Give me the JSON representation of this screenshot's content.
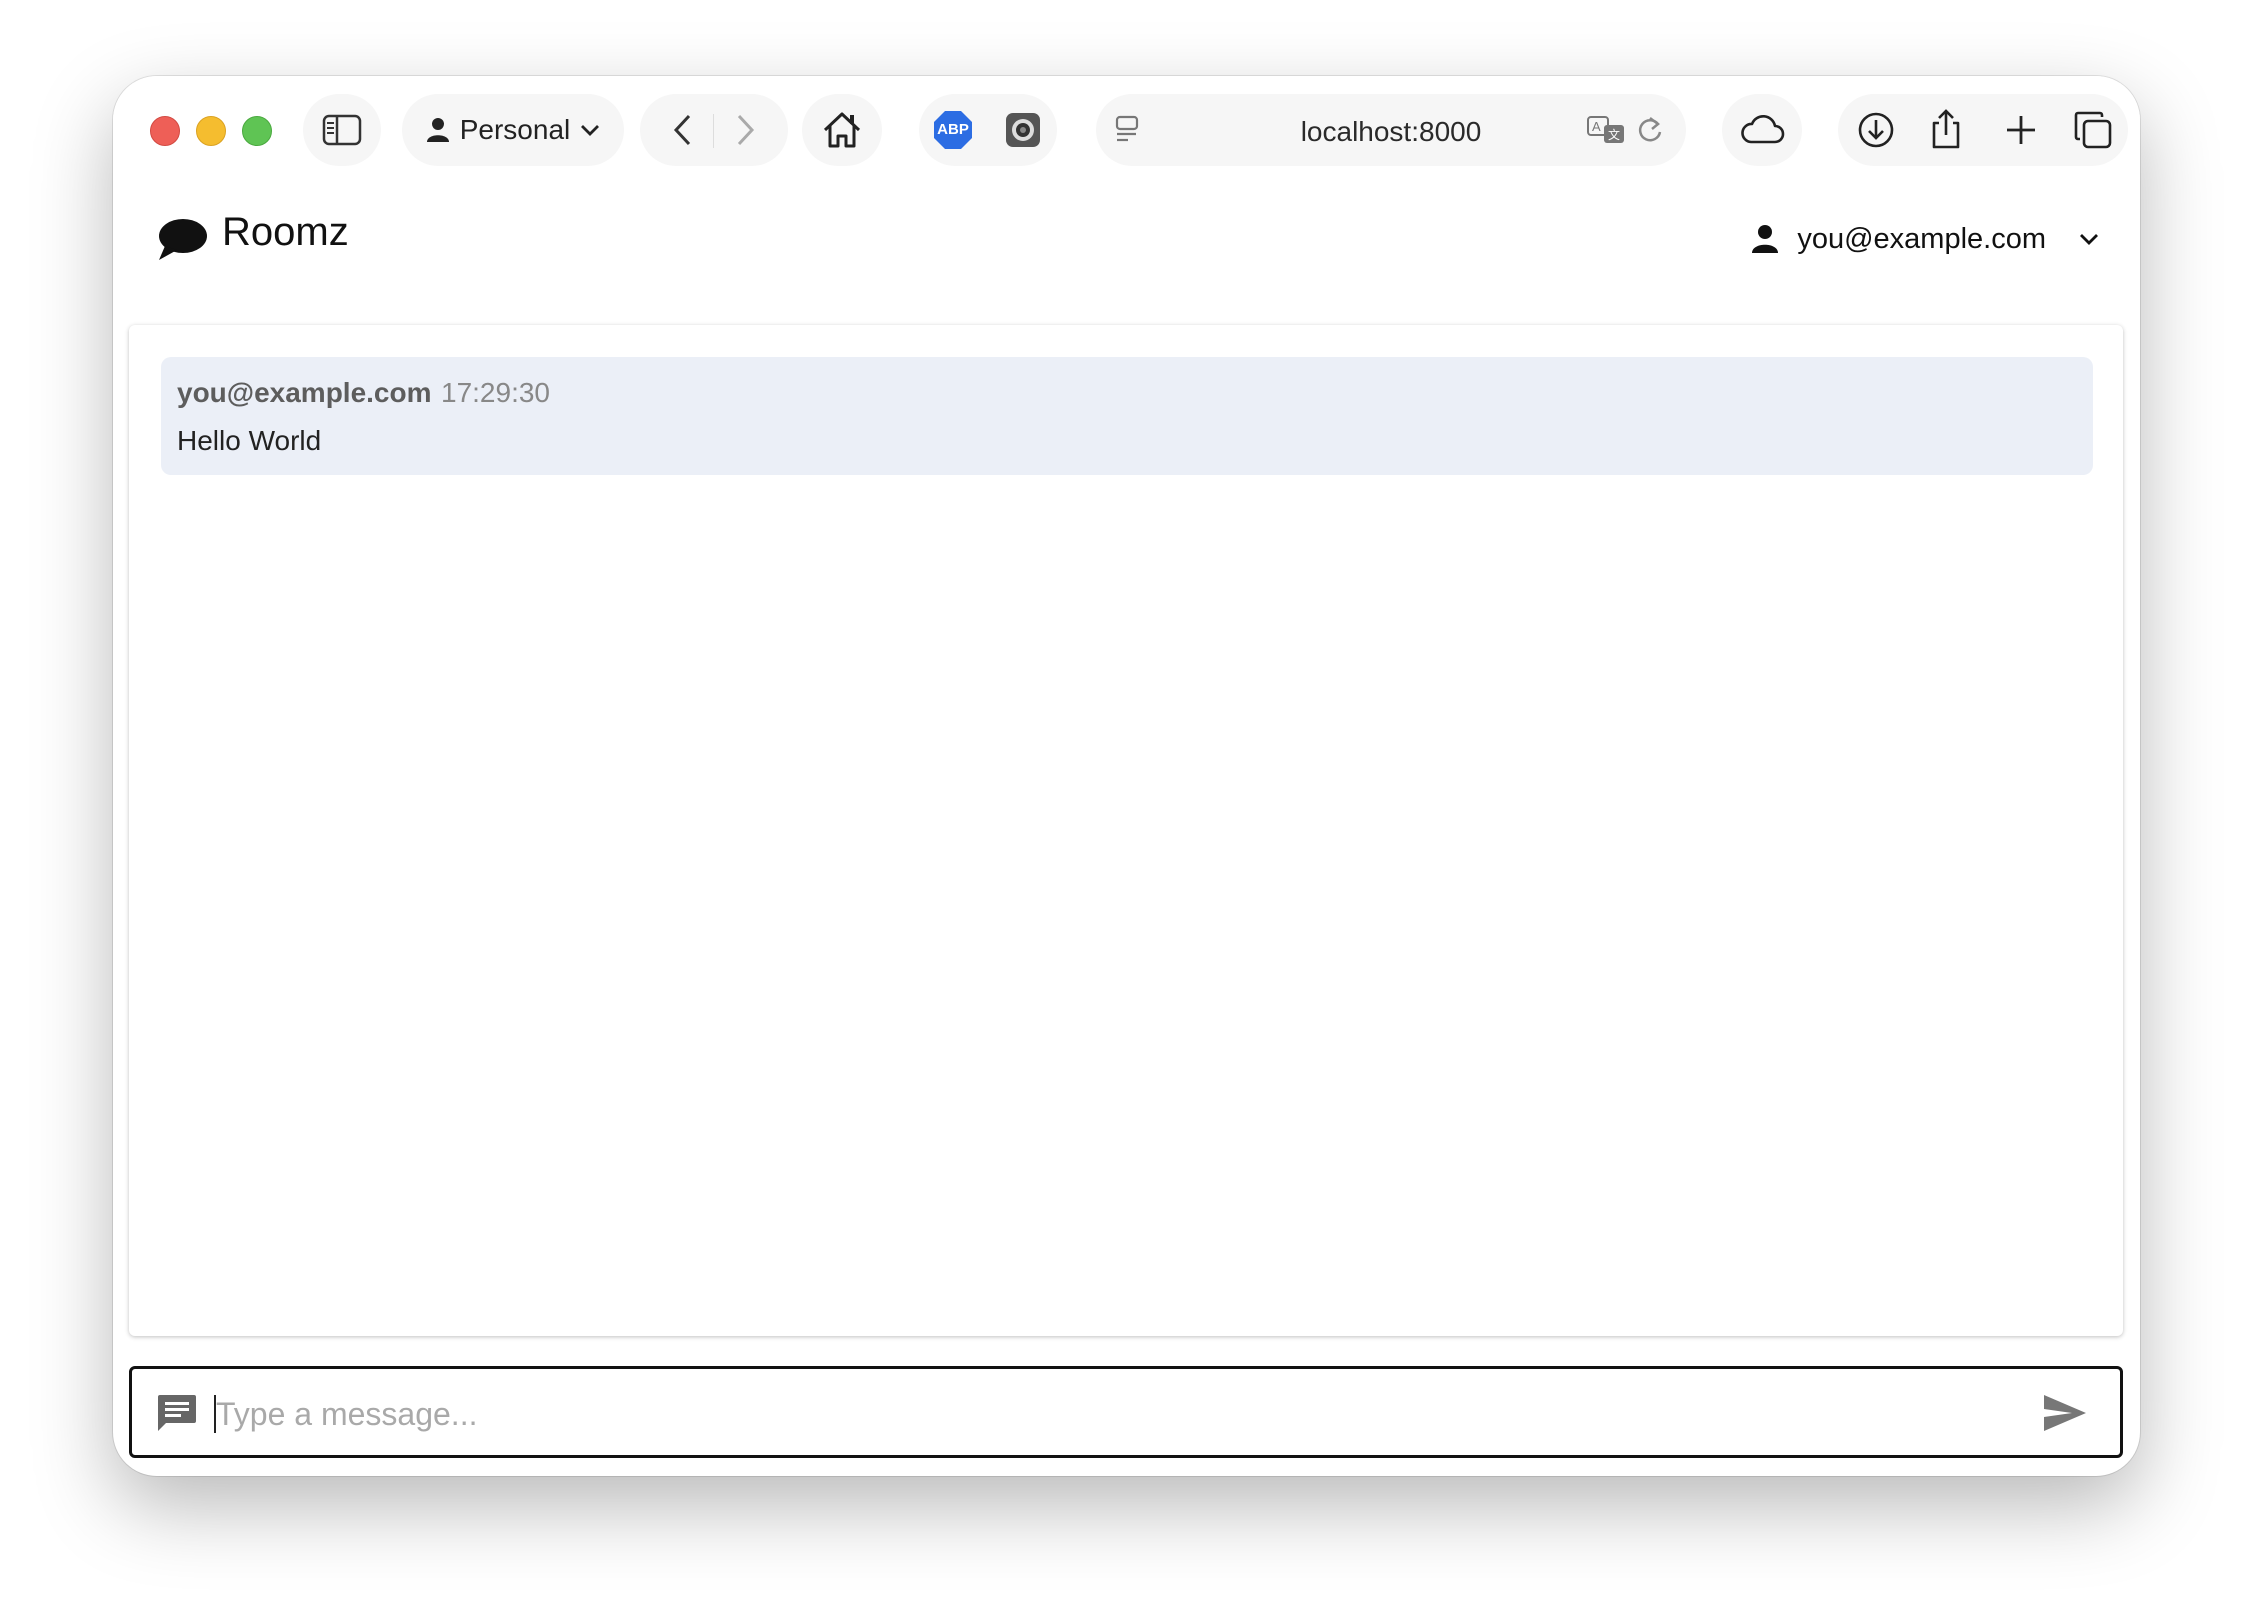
{
  "browser": {
    "profile_label": "Personal",
    "url": "localhost:8000",
    "extension_abp_label": "ABP",
    "icons": {
      "sidebar": "sidebar-icon",
      "profile": "person-icon",
      "back": "chevron-left-icon",
      "forward": "chevron-right-icon",
      "home": "home-icon",
      "reader": "reader-icon",
      "translate": "translate-icon",
      "reload": "reload-icon",
      "cloud": "cloud-icon",
      "download": "download-icon",
      "share": "share-icon",
      "new_tab": "plus-icon",
      "tabs": "tabs-overview-icon"
    },
    "traffic_light_colors": {
      "close": "#ee5f57",
      "minimize": "#f5bd2f",
      "zoom": "#5fc454"
    }
  },
  "app": {
    "title": "Roomz",
    "user_email": "you@example.com"
  },
  "messages": [
    {
      "author": "you@example.com",
      "time": "17:29:30",
      "text": "Hello World"
    }
  ],
  "composer": {
    "placeholder": "Type a message...",
    "value": ""
  },
  "colors": {
    "message_bg": "#ebeff7",
    "author_text": "#5d5d5d",
    "time_text": "#888888"
  }
}
